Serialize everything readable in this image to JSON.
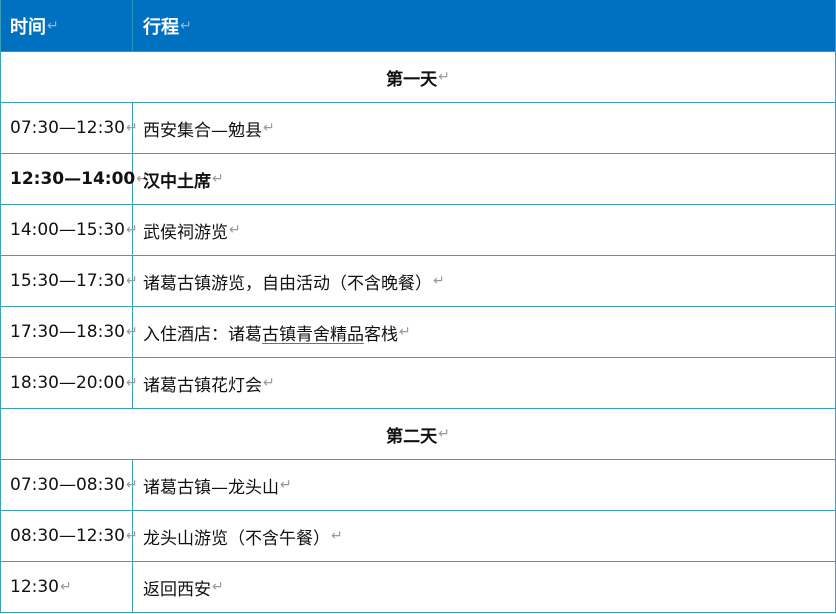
{
  "header": {
    "time_label": "时间",
    "event_label": "行程"
  },
  "para_mark": "↵",
  "days": [
    {
      "title": "第一天",
      "rows": [
        {
          "time": "07:30—12:30",
          "event": "西安集合—勉县"
        },
        {
          "time": "12:30—14:00",
          "event": "汉中土席",
          "bold": true
        },
        {
          "time": "14:00—15:30",
          "event": "武侯祠游览"
        },
        {
          "time": "15:30—17:30",
          "event": "诸葛古镇游览，自由活动（不含晚餐）"
        },
        {
          "time": "17:30—18:30",
          "event_prefix": "入住酒店：诸葛",
          "event_underlined": "古镇青舍精品",
          "event_suffix": "客栈"
        },
        {
          "time": "18:30—20:00",
          "event": "诸葛古镇花灯会"
        }
      ]
    },
    {
      "title": "第二天",
      "rows": [
        {
          "time": "07:30—08:30",
          "event": "诸葛古镇—龙头山"
        },
        {
          "time": "08:30—12:30",
          "event": "龙头山游览（不含午餐）"
        },
        {
          "time": "12:30",
          "event": "返回西安"
        }
      ]
    }
  ]
}
